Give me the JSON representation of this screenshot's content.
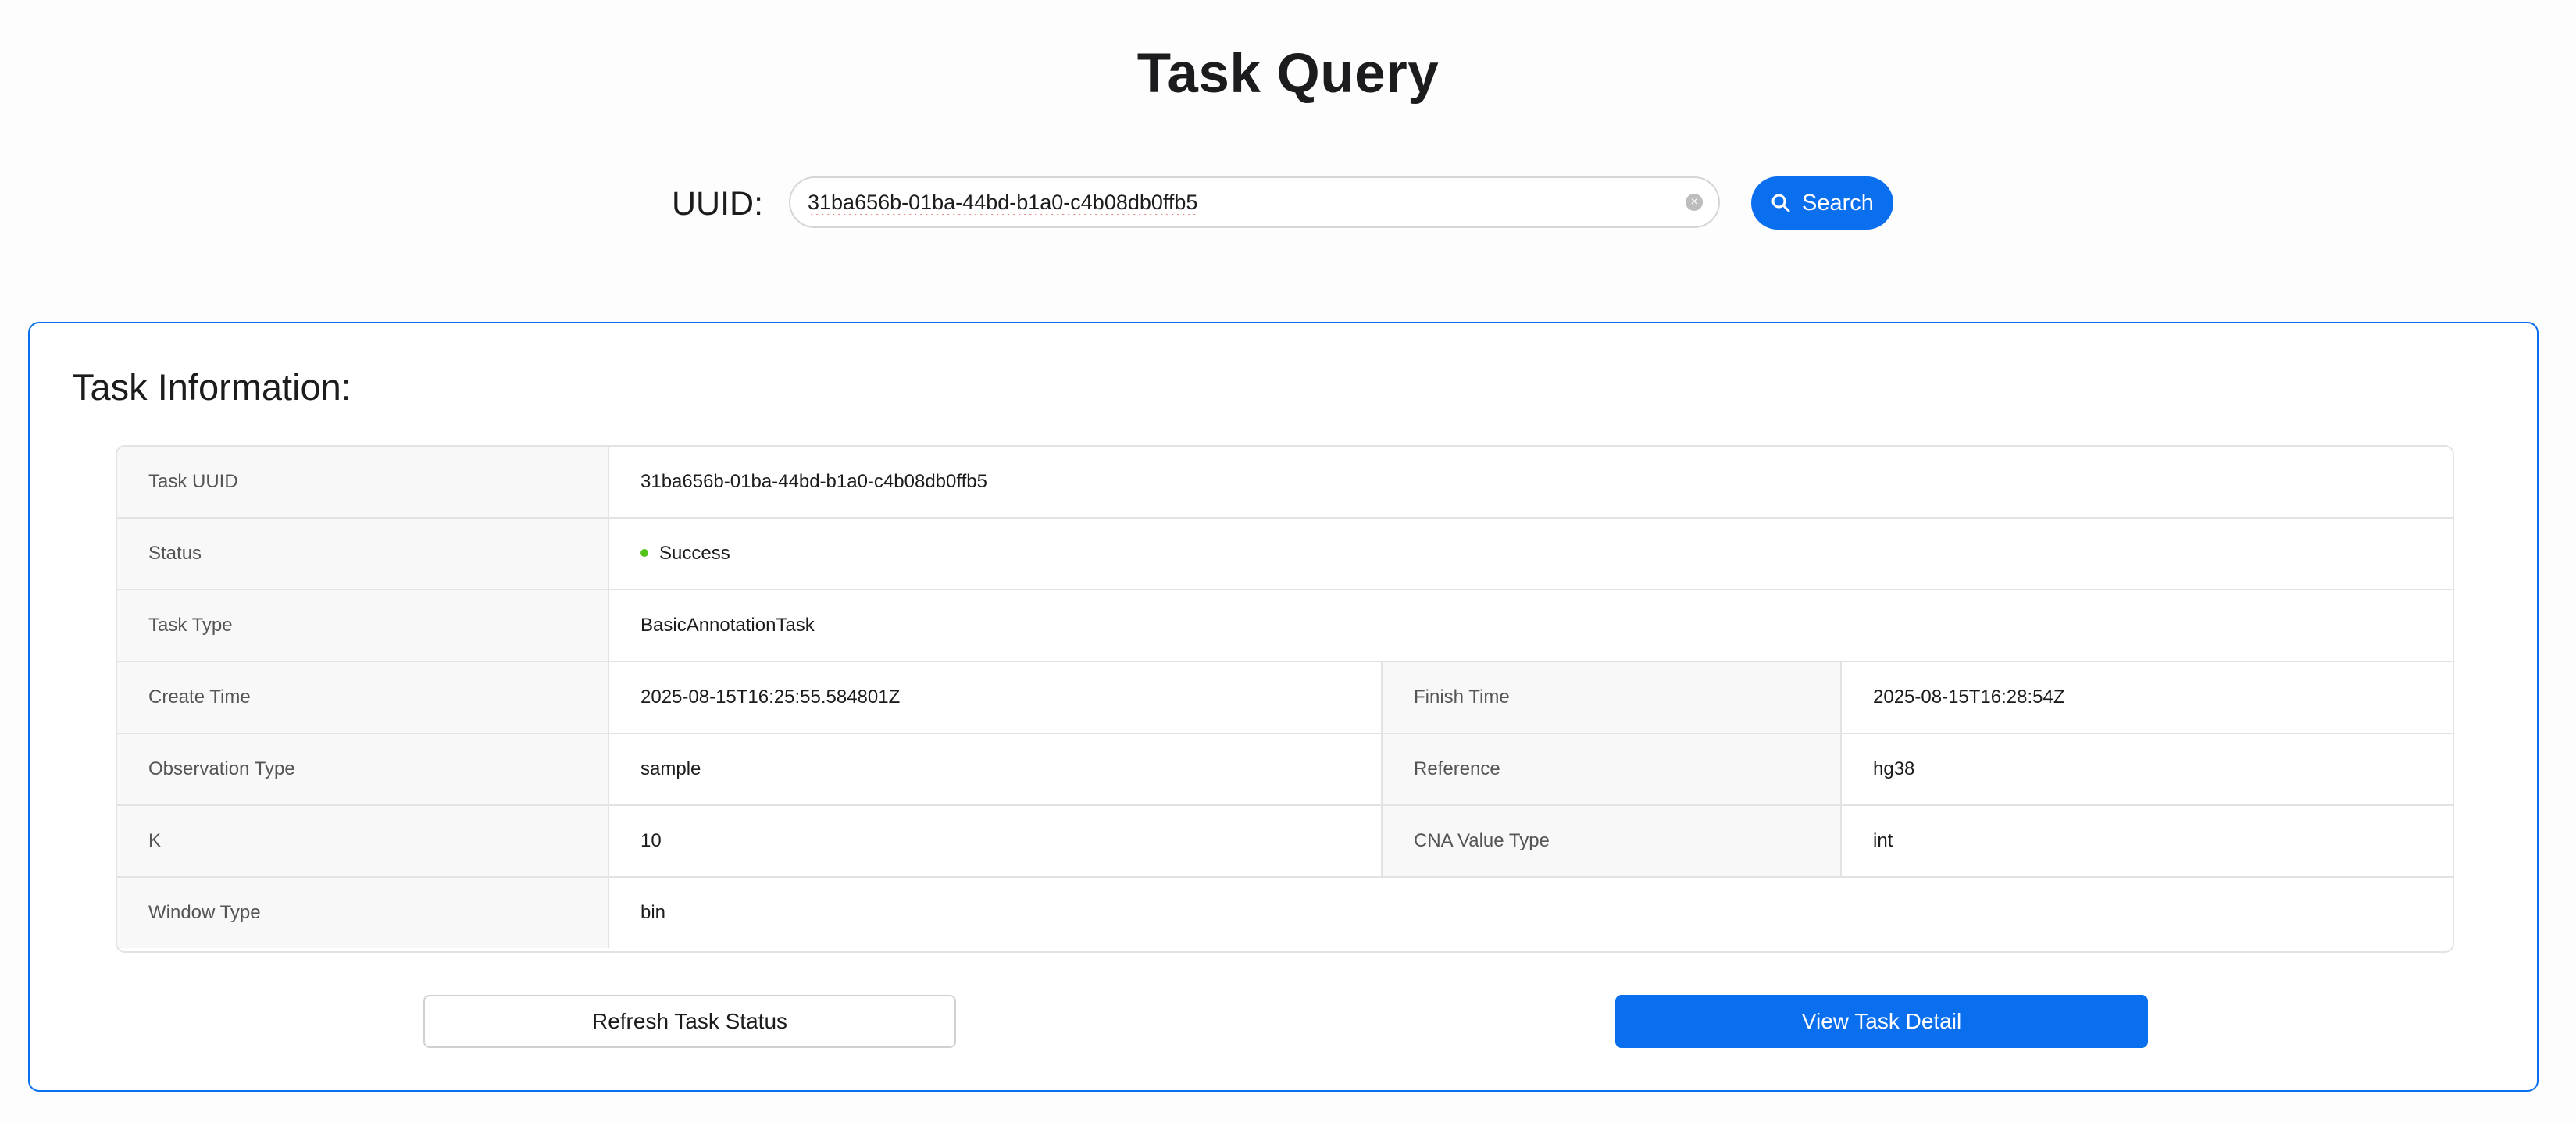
{
  "page": {
    "title": "Task Query"
  },
  "search": {
    "label": "UUID:",
    "value": "31ba656b-01ba-44bd-b1a0-c4b08db0ffb5",
    "clear_icon": "close-circle-icon",
    "button_label": "Search",
    "button_icon": "search-icon"
  },
  "task_info": {
    "heading": "Task Information:",
    "rows": {
      "uuid": {
        "label": "Task UUID",
        "value": "31ba656b-01ba-44bd-b1a0-c4b08db0ffb5"
      },
      "status": {
        "label": "Status",
        "value": "Success",
        "dot_color": "#52c41a"
      },
      "task_type": {
        "label": "Task Type",
        "value": "BasicAnnotationTask"
      },
      "create_time": {
        "label": "Create Time",
        "value": "2025-08-15T16:25:55.584801Z"
      },
      "finish_time": {
        "label": "Finish Time",
        "value": "2025-08-15T16:28:54Z"
      },
      "observation_type": {
        "label": "Observation Type",
        "value": "sample"
      },
      "reference": {
        "label": "Reference",
        "value": "hg38"
      },
      "k": {
        "label": "K",
        "value": "10"
      },
      "cna_value_type": {
        "label": "CNA Value Type",
        "value": "int"
      },
      "window_type": {
        "label": "Window Type",
        "value": "bin"
      }
    },
    "refresh_label": "Refresh Task Status",
    "detail_label": "View Task Detail"
  },
  "colors": {
    "accent": "#0a6fee",
    "success": "#52c41a"
  }
}
